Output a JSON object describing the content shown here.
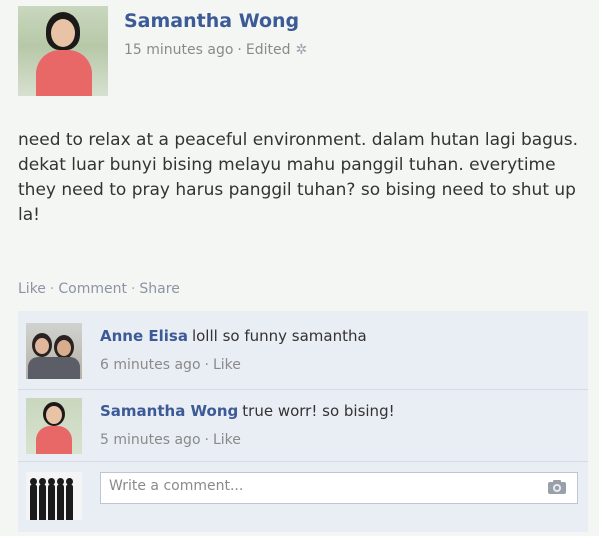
{
  "post": {
    "author": "Samantha Wong",
    "time": "15 minutes ago",
    "edited": "Edited",
    "body": "need to relax at a peaceful environment. dalam hutan lagi bagus. dekat luar bunyi bising melayu mahu panggil tuhan. everytime they need to pray harus panggil tuhan? so bising need to shut up la!",
    "actions": {
      "like": "Like",
      "comment": "Comment",
      "share": "Share"
    }
  },
  "comments": [
    {
      "author": "Anne Elisa",
      "text": "lolll so funny samantha",
      "time": "6 minutes ago",
      "like": "Like"
    },
    {
      "author": "Samantha Wong",
      "text": "true worr! so bising!",
      "time": "5 minutes ago",
      "like": "Like"
    }
  ],
  "composer": {
    "placeholder": "Write a comment..."
  },
  "separator": "·"
}
